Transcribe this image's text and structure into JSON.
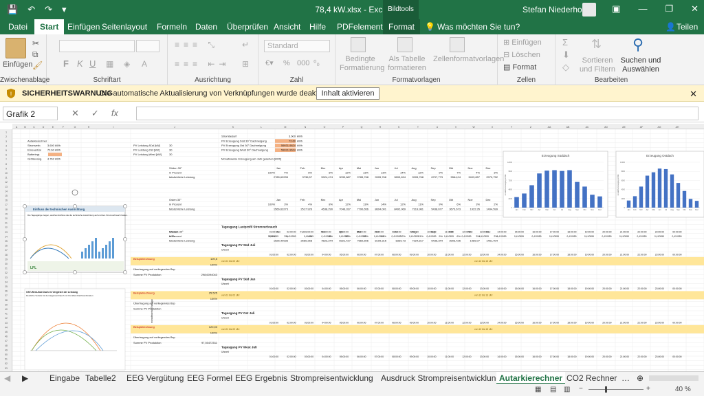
{
  "titlebar": {
    "title": "78,4 kW.xlsx  -  Excel",
    "context_tab": "Bildtools",
    "user": "Stefan Niederhofer"
  },
  "menu": {
    "tabs": [
      "Datei",
      "Start",
      "Einfügen",
      "Seitenlayout",
      "Formeln",
      "Daten",
      "Überprüfen",
      "Ansicht",
      "Hilfe",
      "PDFelement",
      "Format"
    ],
    "tell_me": "Was möchten Sie tun?",
    "share": "Teilen"
  },
  "ribbon": {
    "paste": "Einfügen",
    "groups": {
      "clipboard": "Zwischenablage",
      "font": "Schriftart",
      "alignment": "Ausrichtung",
      "number": "Zahl",
      "styles": "Formatvorlagen",
      "cells": "Zellen",
      "editing": "Bearbeiten"
    },
    "number_format": "Standard",
    "cond_format": "Bedingte Formatierung",
    "as_table": "Als Tabelle formatieren",
    "cell_styles": "Zellenformatvorlagen",
    "insert": "Einfügen",
    "delete": "Löschen",
    "format": "Format",
    "sort_filter": "Sortieren und Filtern",
    "find_select": "Suchen und Auswählen",
    "bold": "F",
    "italic": "K",
    "underline": "U",
    "percent": "%",
    "thousands": "000"
  },
  "warning": {
    "title": "SICHERHEITSWARNUNG",
    "message": "Die automatische Aktualisierung von Verknüpfungen wurde deaktiviert.",
    "button": "Inhalt aktivieren"
  },
  "formula_bar": {
    "namebox": "Grafik 2",
    "fx": "fx",
    "cancel": "✕",
    "confirm": "✓"
  },
  "sheet": {
    "left_table": [
      [
        "Autarkierechner",
        ""
      ],
      [
        "Stromverb.",
        "3.600 kWh"
      ],
      [
        "Erneuerbar",
        "72,60 kWh"
      ],
      [
        "Batteriegr.",
        ""
      ],
      [
        "Größenang.",
        "4,762 kWh"
      ]
    ],
    "pv_labels": [
      "PV Leistung Süd [kW]",
      "PV Leistung Ost [kW]",
      "PV Leistung West [kW]"
    ],
    "pv_values": [
      "30",
      "30",
      "30"
    ],
    "strombedarf": [
      [
        "Strombedarf",
        "3.600",
        "kWh"
      ],
      [
        "PV Erzeugung Süd 30° Dachneigung",
        "72,60",
        "kWh"
      ],
      [
        "PV Erzeugung Ost 30° Dachneigung",
        "59931,9624",
        "kWh"
      ],
      [
        "PV Erzeugung West 30° Dachneigung",
        "59931,9624",
        "kWh"
      ]
    ],
    "monthly_header": "Monatsweise Erzeugung am Jahr gesehen [kWh]",
    "months": [
      "Jan",
      "Feb",
      "Mrz",
      "Apr",
      "Mai",
      "Jun",
      "Jul",
      "Aug",
      "Sep",
      "Okt",
      "Nov",
      "Dez"
    ],
    "blocks": [
      {
        "name": "Süden 30°",
        "pct": [
          "4%",
          "5%",
          "8%",
          "12%",
          "13%",
          "13%",
          "14%",
          "12%",
          "9%",
          "7%",
          "4%",
          "3%"
        ],
        "values": [
          "2785,60935",
          "3736,57",
          "5924,474",
          "9039,887",
          "9785,768",
          "9905,768",
          "9699,694",
          "9905,768",
          "6797,773",
          "5564,04",
          "3403,657",
          "2970,752"
        ]
      },
      {
        "name": "Osten 30°",
        "pct": [
          "3%",
          "4%",
          "8%",
          "12%",
          "13%",
          "14%",
          "12%",
          "11%",
          "9%",
          "6%",
          "3%",
          "2%"
        ],
        "values": [
          "1566,63273",
          "2517,926",
          "4638,290",
          "7046,337",
          "7790,656",
          "8604,001",
          "8492,969",
          "7319,981",
          "5438,677",
          "3673,673",
          "1922,35",
          "1494,599"
        ]
      },
      {
        "name": "Westen 30°",
        "pct": [
          "3%",
          "4%",
          "8%",
          "12%",
          "13%",
          "14%",
          "12%",
          "11%",
          "9%",
          "6%",
          "3%",
          "2%"
        ],
        "values": [
          "1525,40936",
          "2560,258",
          "4623,244",
          "6921,427",
          "7660,606",
          "8199,315",
          "8339,73",
          "7324,817",
          "5436,344",
          "3903,425",
          "1989,07",
          "1451,404"
        ]
      }
    ],
    "row_label_pct": "in Prozent",
    "row_label_actual": "tatsächliche Leistung",
    "vertical_label": "monatsweise Erzeugung",
    "lastprofil_title": "Tagesgang Lastprofil Stromverbrauch",
    "hours": [
      "01:00:00",
      "02:00:00",
      "03:00:00",
      "04:00:00",
      "05:00:00",
      "06:00:00",
      "07:00:00",
      "08:00:00",
      "09:00:00",
      "10:00:00",
      "11:00:00",
      "12:00:00",
      "13:00:00",
      "14:00:00",
      "15:00:00",
      "16:00:00",
      "17:00:00",
      "18:00:00",
      "19:00:00",
      "20:00:00",
      "21:00:00",
      "22:00:00",
      "23:00:00",
      "00:00:00"
    ],
    "load_value": "0,410959",
    "uhrzeit": "Uhrzeit",
    "kwh": "kWh",
    "tagesgang_sections": [
      {
        "title": "Tagesgang PV Süd Juli",
        "example_value": "109,5",
        "range_left": "von 01 bis 02 Uhr",
        "range_right": "von 12 bis 13 Uhr",
        "sum_label": "Summe PV Produktion",
        "sum_value": "298,6094043"
      },
      {
        "title": "Tagesgang PV Süd Jan",
        "example_value": "25,525",
        "range_left": "von 01 bis 02 Uhr",
        "range_right": "von 12 bis 13 Uhr",
        "sum_label": "Summe PV Produktion",
        "sum_value": ""
      },
      {
        "title": "Tagesgang PV Ost Juli",
        "example_value": "120,03",
        "range_left": "von 01 bis 02 Uhr",
        "range_right": "von 12 bis 13 Uhr",
        "sum_label": "Summe PV Produktion",
        "sum_value": "97,50472511"
      },
      {
        "title": "Tagesgang PV West Juli",
        "example_value": "",
        "range_left": "",
        "range_right": "",
        "sum_label": "Summe PV Produktion",
        "sum_value": "273,6441657"
      }
    ],
    "beispiel": "Beispielrechnung",
    "uebertrag": "Übertragung auf vorliegendes Bsp",
    "image_title": "Einfluss der technischen Ausrichtung",
    "image_caption": "Die Tagesgänge zeigen, welchen Einfluss die die technische Ausrichtung auf und den Stromverbrauch haben.",
    "image_logo": "LFL",
    "image2_title": "OST-West-Süd Dach im Vergleich der Leistung",
    "image2_sub": "Deutliche Vorteile für den Eigenverbrauch mit Ost-West Dachkombination"
  },
  "chart_data": [
    {
      "type": "bar",
      "title": "Erzeugung Süddach",
      "categories": [
        "Jan",
        "Feb",
        "Mrz",
        "Apr",
        "Mai",
        "Jun",
        "Jul",
        "Aug",
        "Sep",
        "Okt",
        "Nov",
        "Dez"
      ],
      "values": [
        2786,
        3737,
        5924,
        9040,
        9786,
        9906,
        9700,
        9906,
        6798,
        5564,
        3404,
        2971
      ],
      "ylim": [
        0,
        12000
      ],
      "ylabel": "monatliche Erzeugung in kWh",
      "color": "#4472c4"
    },
    {
      "type": "bar",
      "title": "Erzeugung Ostdach",
      "categories": [
        "Jan",
        "Feb",
        "Mrz",
        "Apr",
        "Mai",
        "Jun",
        "Jul",
        "Aug",
        "Sep",
        "Okt",
        "Nov",
        "Dez"
      ],
      "values": [
        1567,
        2518,
        4638,
        7046,
        7791,
        8604,
        8493,
        7320,
        5439,
        3674,
        1922,
        1495
      ],
      "ylim": [
        0,
        10000
      ],
      "ylabel": "monatliche Erzeugung in kWh",
      "color": "#4472c4"
    }
  ],
  "sheets": {
    "tabs": [
      "Eingabe",
      "Tabelle2",
      "EEG Vergütung",
      "EEG Formel",
      "EEG Ergebnis",
      "Strompreisentwicklung",
      "Ausdruck Strompreisentwicklung",
      "Autarkierechner",
      "CO2 Rechner"
    ],
    "active": "Autarkierechner"
  },
  "statusbar": {
    "zoom": "40 %"
  },
  "colors": {
    "excel_green": "#217346",
    "warning_bg": "#fff4ce",
    "highlight": "#ffe699",
    "bar": "#4472c4"
  }
}
